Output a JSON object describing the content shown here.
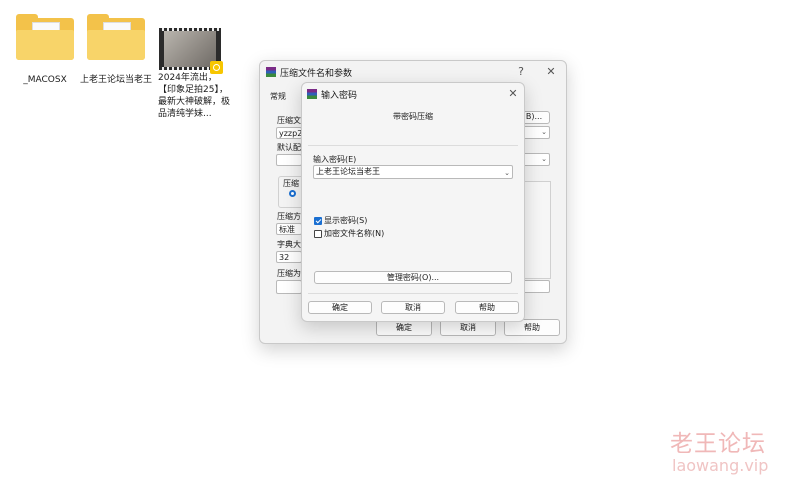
{
  "desktop": {
    "icons": [
      {
        "label": "_MACOSX"
      },
      {
        "label": "上老王论坛当老王"
      },
      {
        "label": "2024年流出，【印象足拍25】，最新大神破解，极品清纯学妹..."
      }
    ]
  },
  "main_dialog": {
    "title": "压缩文件名和参数",
    "help_glyph": "?",
    "close_glyph": "✕",
    "tab_general": "常规",
    "archive_label": "压缩文",
    "archive_value": "yzzp25",
    "browse_label": "B)...",
    "default_label": "默认配",
    "format_group": "压缩",
    "method_label": "压缩方",
    "method_value": "标准",
    "dict_label": "字典大",
    "dict_value": "32",
    "split_label": "压缩为",
    "ok_label": "确定",
    "cancel_label": "取消",
    "help_label": "帮助"
  },
  "password_dialog": {
    "title": "输入密码",
    "close_glyph": "✕",
    "heading": "带密码压缩",
    "password_label": "输入密码(E)",
    "password_value": "上老王论坛当老王",
    "show_password_label": "显示密码(S)",
    "show_password_checked": true,
    "encrypt_names_label": "加密文件名称(N)",
    "encrypt_names_checked": false,
    "manage_label": "管理密码(O)...",
    "ok_label": "确定",
    "cancel_label": "取消",
    "help_label": "帮助"
  },
  "watermark": {
    "cn": "老王论坛",
    "en": "laowang.vip"
  }
}
